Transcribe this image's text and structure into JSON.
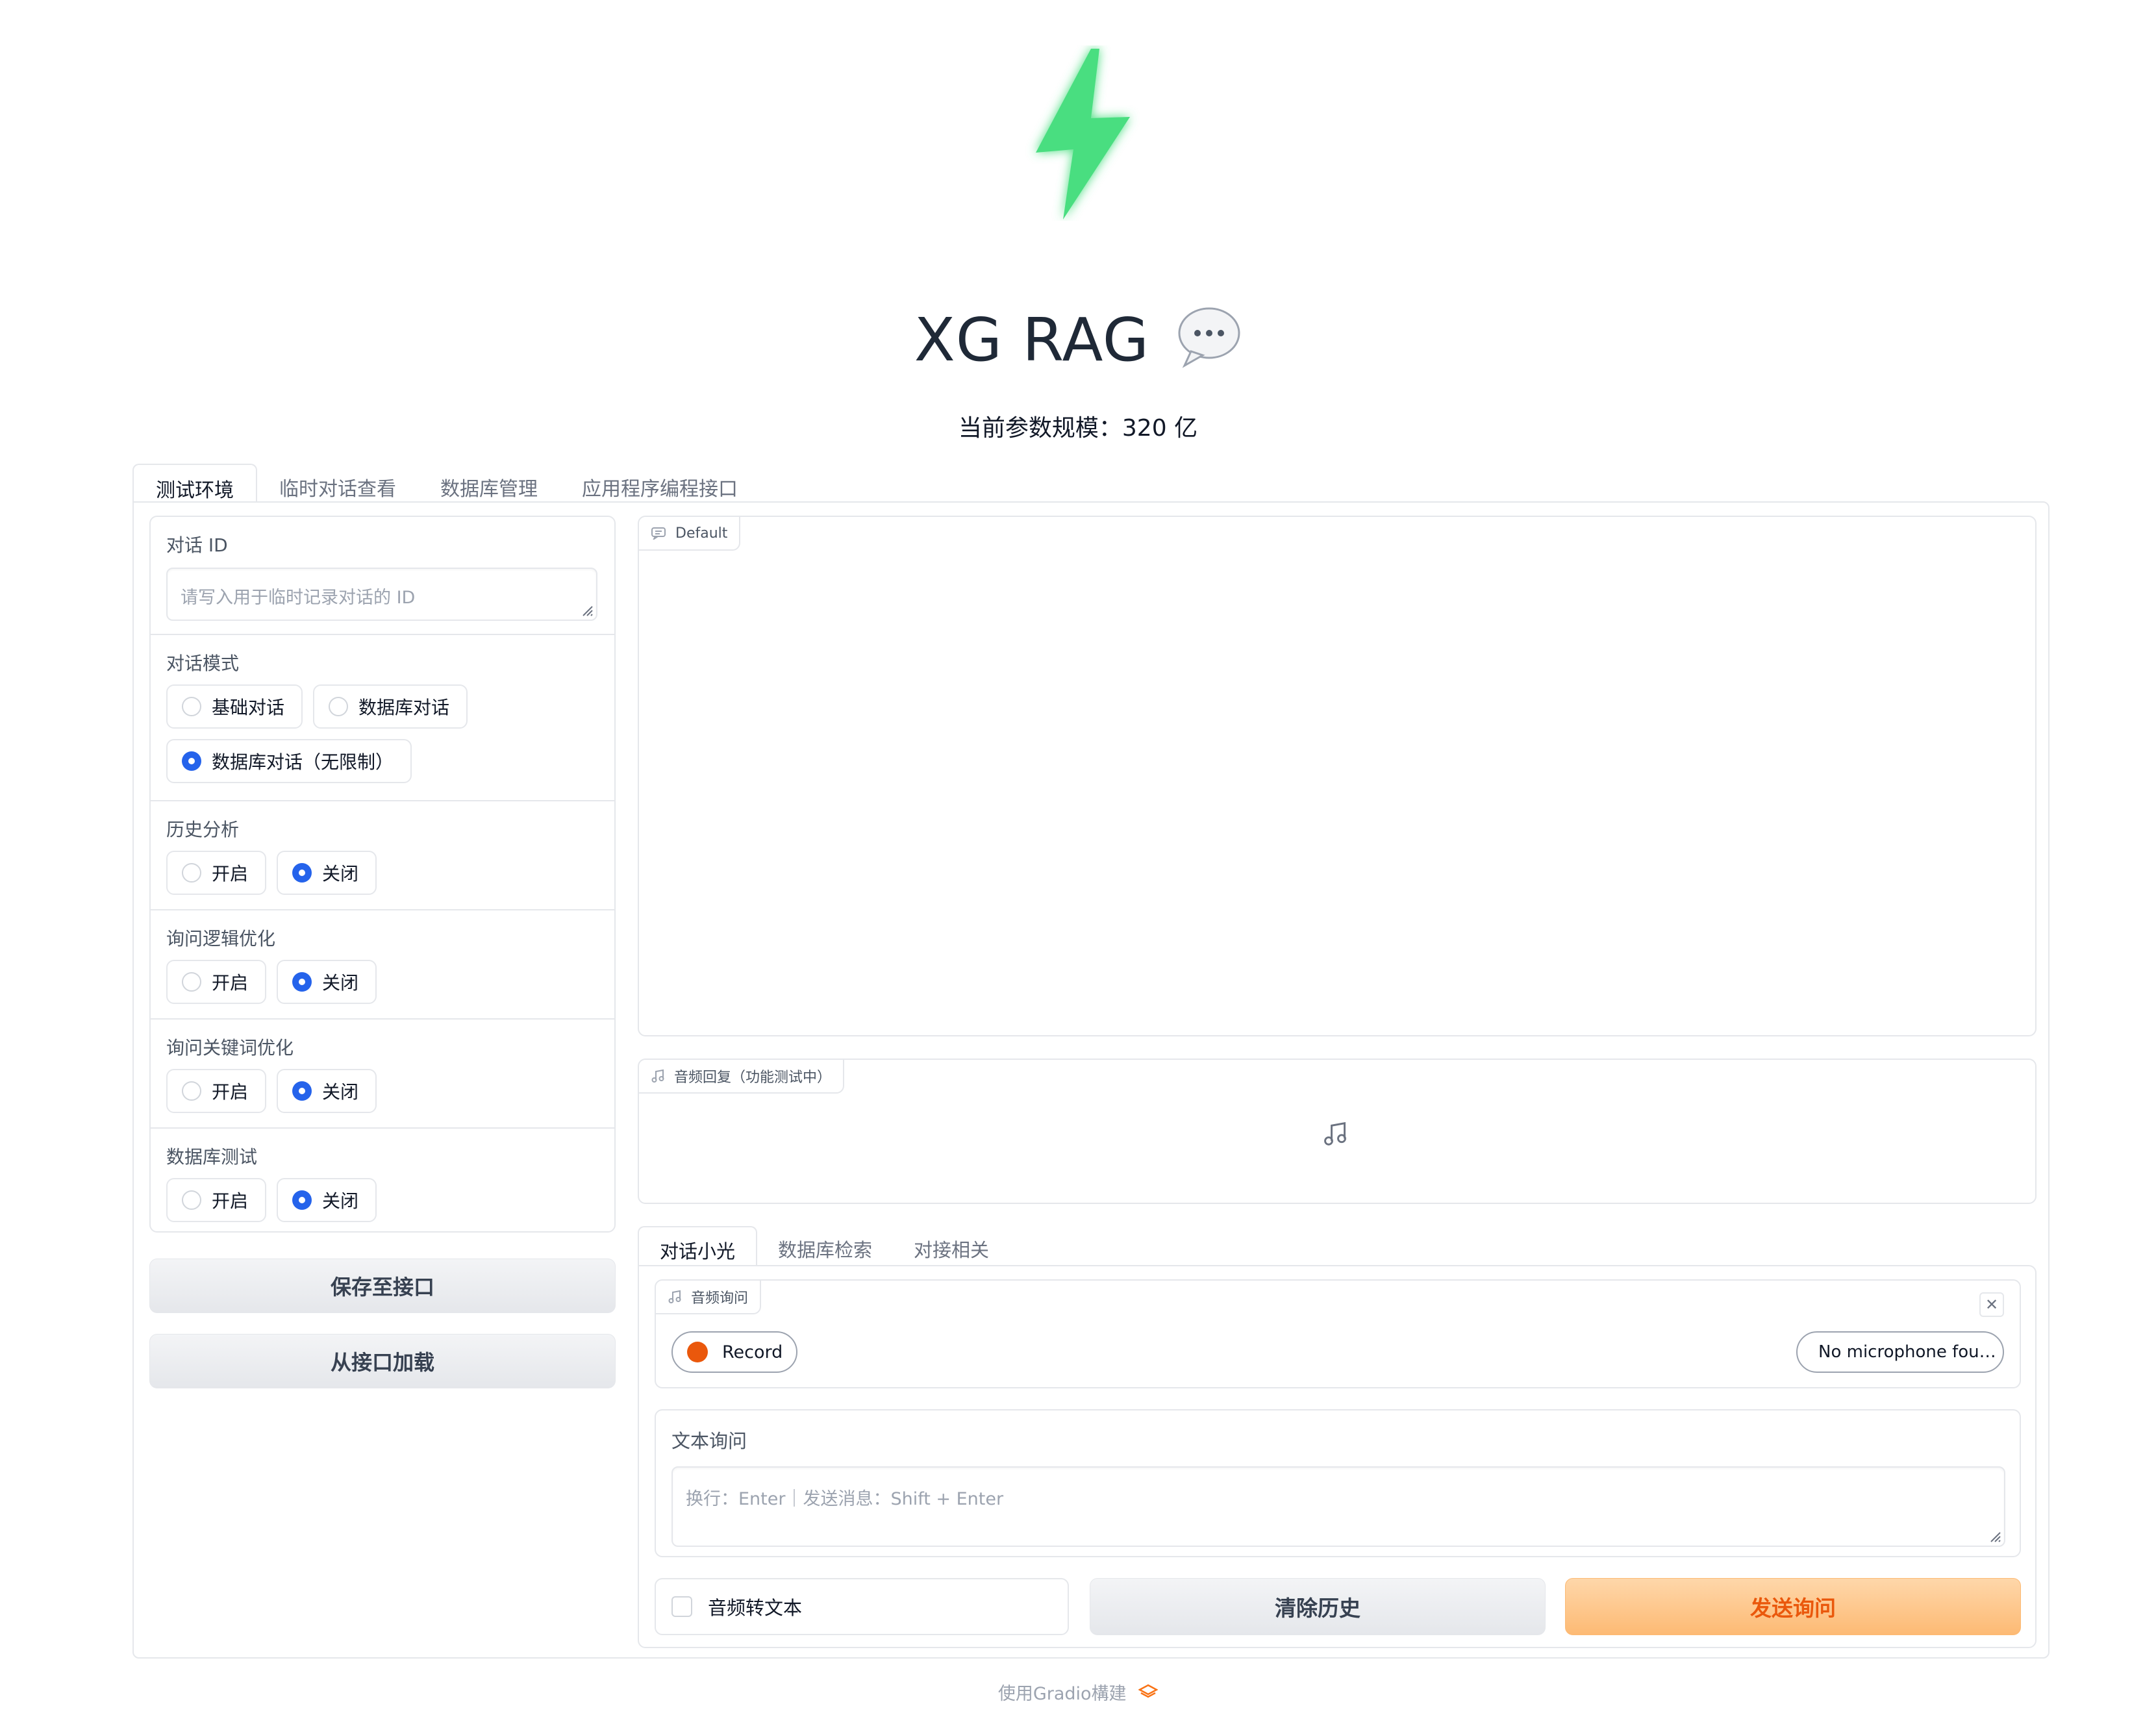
{
  "header": {
    "logo_icon": "lightning-bolt-icon",
    "logo_color": "#4ade80",
    "title": "XG RAG",
    "title_emoji": "💬",
    "subtitle": "当前参数规模：320 亿"
  },
  "top_tabs": [
    {
      "label": "测试环境",
      "active": true
    },
    {
      "label": "临时对话查看",
      "active": false
    },
    {
      "label": "数据库管理",
      "active": false
    },
    {
      "label": "应用程序编程接口",
      "active": false
    }
  ],
  "left": {
    "dialog_id": {
      "label": "对话 ID",
      "placeholder": "请写入用于临时记录对话的 ID",
      "value": ""
    },
    "dialog_mode": {
      "label": "对话模式",
      "options": [
        "基础对话",
        "数据库对话",
        "数据库对话（无限制）"
      ],
      "selected": "数据库对话（无限制）"
    },
    "history_analysis": {
      "label": "历史分析",
      "options": [
        "开启",
        "关闭"
      ],
      "selected": "关闭"
    },
    "query_logic": {
      "label": "询问逻辑优化",
      "options": [
        "开启",
        "关闭"
      ],
      "selected": "关闭"
    },
    "query_keyword": {
      "label": "询问关键词优化",
      "options": [
        "开启",
        "关闭"
      ],
      "selected": "关闭"
    },
    "db_test": {
      "label": "数据库测试",
      "options": [
        "开启",
        "关闭"
      ],
      "selected": "关闭"
    },
    "save_button": "保存至接口",
    "load_button": "从接口加载"
  },
  "right": {
    "chatbot_label": "Default",
    "audio_reply_label": "音频回复（功能测试中）",
    "inner_tabs": [
      {
        "label": "对话小光",
        "active": true
      },
      {
        "label": "数据库检索",
        "active": false
      },
      {
        "label": "对接相关",
        "active": false
      }
    ],
    "audio_query_label": "音频询问",
    "record_label": "Record",
    "record_color": "#ea580c",
    "mic_select": "No microphone fou…",
    "text_query_label": "文本询问",
    "text_query_placeholder": "换行：Enter｜发送消息：Shift + Enter",
    "audio_to_text_label": "音频转文本",
    "clear_button": "清除历史",
    "send_button": "发送询问",
    "send_color": "#ea580c"
  },
  "footer": {
    "text": "使用Gradio構建",
    "icon": "gradio-logo-icon"
  }
}
